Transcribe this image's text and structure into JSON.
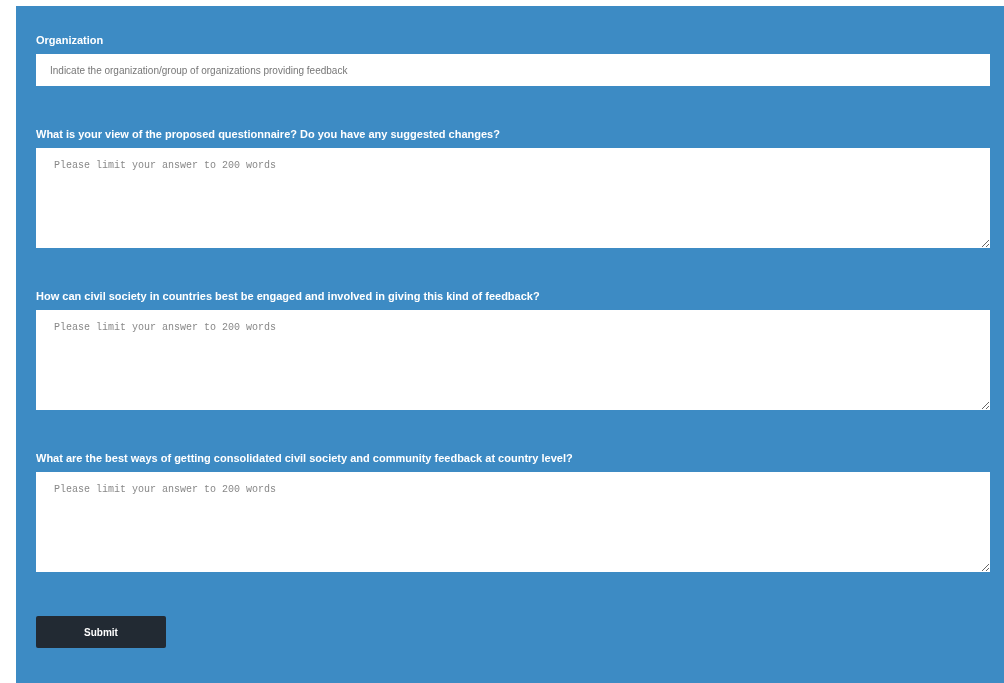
{
  "organization": {
    "label": "Organization",
    "placeholder": "Indicate the organization/group of organizations providing feedback"
  },
  "questions": [
    {
      "label": "What is your view of the proposed questionnaire? Do you have any suggested changes?",
      "placeholder": "Please limit your answer to 200 words"
    },
    {
      "label": "How can civil society in countries best be engaged and involved in giving this kind of feedback?",
      "placeholder": "Please limit your answer to 200 words"
    },
    {
      "label": "What are the best ways of getting consolidated civil society and community feedback at country level?",
      "placeholder": "Please limit your answer to 200 words"
    }
  ],
  "submit": "Submit"
}
